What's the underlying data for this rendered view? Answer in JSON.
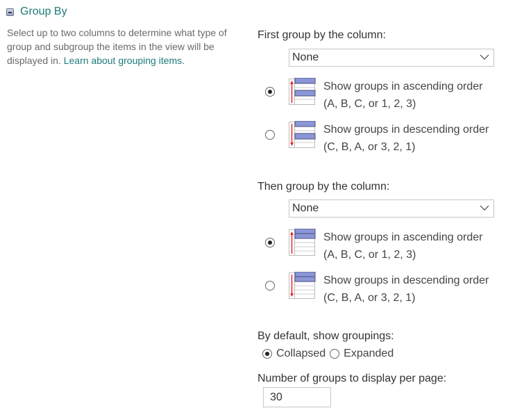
{
  "section": {
    "title": "Group By",
    "description": "Select up to two columns to determine what type of group and subgroup the items in the view will be displayed in.",
    "link_label": "Learn about grouping items."
  },
  "first_group": {
    "label": "First group by the column:",
    "selected": "None",
    "options": [
      {
        "title": "Show groups in ascending order",
        "subtitle": "(A, B, C, or 1, 2, 3)",
        "checked": true,
        "icon": "sort-ascending-icon"
      },
      {
        "title": "Show groups in descending order",
        "subtitle": "(C, B, A, or 3, 2, 1)",
        "checked": false,
        "icon": "sort-descending-icon"
      }
    ]
  },
  "then_group": {
    "label": "Then group by the column:",
    "selected": "None",
    "options": [
      {
        "title": "Show groups in ascending order",
        "subtitle": "(A, B, C, or 1, 2, 3)",
        "checked": true,
        "icon": "sort-ascending-icon"
      },
      {
        "title": "Show groups in descending order",
        "subtitle": "(C, B, A, or 3, 2, 1)",
        "checked": false,
        "icon": "sort-descending-icon"
      }
    ]
  },
  "default_groupings": {
    "label": "By default, show groupings:",
    "options": [
      {
        "label": "Collapsed",
        "checked": true
      },
      {
        "label": "Expanded",
        "checked": false
      }
    ]
  },
  "groups_per_page": {
    "label": "Number of groups to display per page:",
    "value": "30"
  },
  "colors": {
    "accent": "#1e7a7a",
    "icon_header": "#8b96d6",
    "arrow": "#e0282e"
  }
}
